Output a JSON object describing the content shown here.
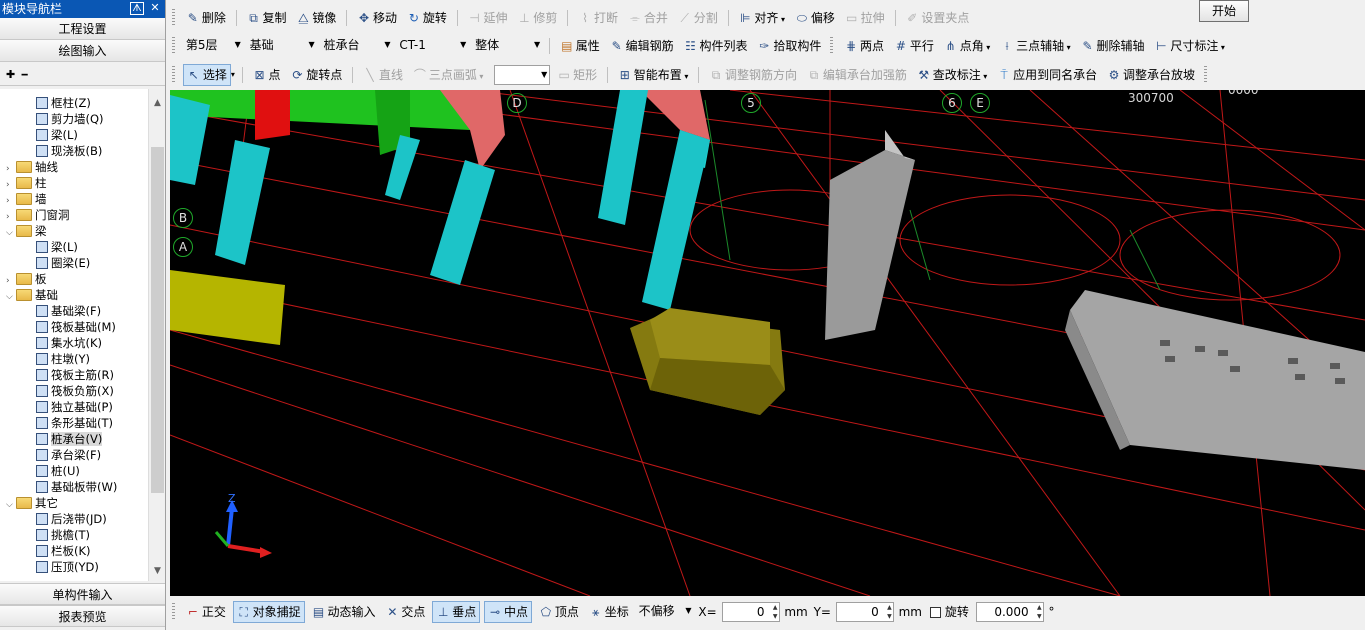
{
  "nav": {
    "title": "模块导航栏",
    "pin_label": "ᗑ",
    "close_label": "✕",
    "project_settings": "工程设置",
    "drawing_input": "绘图输入",
    "tool_add": "✚",
    "tool_remove": "━",
    "single_component_input": "单构件输入",
    "report_preview": "报表预览",
    "tree": [
      {
        "label": "框柱(Z)",
        "indent": 2,
        "type": "leaf"
      },
      {
        "label": "剪力墙(Q)",
        "indent": 2,
        "type": "leaf"
      },
      {
        "label": "梁(L)",
        "indent": 2,
        "type": "leaf"
      },
      {
        "label": "现浇板(B)",
        "indent": 2,
        "type": "leaf"
      },
      {
        "label": "轴线",
        "indent": 1,
        "type": "folder",
        "exp": ">"
      },
      {
        "label": "柱",
        "indent": 1,
        "type": "folder",
        "exp": ">"
      },
      {
        "label": "墙",
        "indent": 1,
        "type": "folder",
        "exp": ">"
      },
      {
        "label": "门窗洞",
        "indent": 1,
        "type": "folder",
        "exp": ">"
      },
      {
        "label": "梁",
        "indent": 1,
        "type": "folder",
        "exp": "v"
      },
      {
        "label": "梁(L)",
        "indent": 2,
        "type": "leaf"
      },
      {
        "label": "圈梁(E)",
        "indent": 2,
        "type": "leaf"
      },
      {
        "label": "板",
        "indent": 1,
        "type": "folder",
        "exp": ">"
      },
      {
        "label": "基础",
        "indent": 1,
        "type": "folder",
        "exp": "v"
      },
      {
        "label": "基础梁(F)",
        "indent": 2,
        "type": "leaf"
      },
      {
        "label": "筏板基础(M)",
        "indent": 2,
        "type": "leaf"
      },
      {
        "label": "集水坑(K)",
        "indent": 2,
        "type": "leaf"
      },
      {
        "label": "柱墩(Y)",
        "indent": 2,
        "type": "leaf"
      },
      {
        "label": "筏板主筋(R)",
        "indent": 2,
        "type": "leaf"
      },
      {
        "label": "筏板负筋(X)",
        "indent": 2,
        "type": "leaf"
      },
      {
        "label": "独立基础(P)",
        "indent": 2,
        "type": "leaf"
      },
      {
        "label": "条形基础(T)",
        "indent": 2,
        "type": "leaf"
      },
      {
        "label": "桩承台(V)",
        "indent": 2,
        "type": "leaf",
        "selected": true
      },
      {
        "label": "承台梁(F)",
        "indent": 2,
        "type": "leaf"
      },
      {
        "label": "桩(U)",
        "indent": 2,
        "type": "leaf"
      },
      {
        "label": "基础板带(W)",
        "indent": 2,
        "type": "leaf"
      },
      {
        "label": "其它",
        "indent": 1,
        "type": "folder",
        "exp": "v"
      },
      {
        "label": "后浇带(JD)",
        "indent": 2,
        "type": "leaf"
      },
      {
        "label": "挑檐(T)",
        "indent": 2,
        "type": "leaf"
      },
      {
        "label": "栏板(K)",
        "indent": 2,
        "type": "leaf"
      },
      {
        "label": "压顶(YD)",
        "indent": 2,
        "type": "leaf"
      }
    ]
  },
  "toolbar1": {
    "delete": "删除",
    "copy": "复制",
    "mirror": "镜像",
    "move": "移动",
    "rotate": "旋转",
    "extend": "延伸",
    "trim": "修剪",
    "break": "打断",
    "merge": "合并",
    "split": "分割",
    "align": "对齐",
    "offset": "偏移",
    "stretch": "拉伸",
    "set_grip": "设置夹点"
  },
  "start_button": "开始",
  "toolbar2": {
    "floor": "第5层",
    "category": "基础",
    "component_type": "桩承台",
    "component": "CT-1",
    "scope": "整体",
    "properties": "属性",
    "edit_rebar": "编辑钢筋",
    "component_list": "构件列表",
    "pick_component": "拾取构件",
    "two_points": "两点",
    "parallel": "平行",
    "point_angle": "点角",
    "three_point_axis": "三点辅轴",
    "delete_aux": "删除辅轴",
    "dimension": "尺寸标注"
  },
  "toolbar3": {
    "select": "选择",
    "point": "点",
    "rotate_point": "旋转点",
    "line": "直线",
    "three_point_arc": "三点画弧",
    "rect": "矩形",
    "smart_layout": "智能布置",
    "adjust_rebar_dir": "调整钢筋方向",
    "edit_cap_reinforce": "编辑承台加强筋",
    "check_label": "查改标注",
    "apply_same_name": "应用到同名承台",
    "adjust_cap_slope": "调整承台放坡"
  },
  "viewport": {
    "axis_labels": [
      "D",
      "5",
      "6",
      "E",
      "B",
      "A"
    ],
    "dim_text": "300700",
    "dim_text2": "0000",
    "gizmo_z": "Z"
  },
  "status": {
    "ortho": "正交",
    "object_snap": "对象捕捉",
    "dynamic_input": "动态输入",
    "intersection": "交点",
    "perpendicular": "垂点",
    "midpoint": "中点",
    "vertex": "顶点",
    "coordinate": "坐标",
    "offset_mode": "不偏移",
    "x_label": "X=",
    "x_value": "0",
    "unit_mm": "mm",
    "y_label": "Y=",
    "y_value": "0",
    "rotate_label": "旋转",
    "rotate_value": "0.000",
    "degree": "°"
  }
}
